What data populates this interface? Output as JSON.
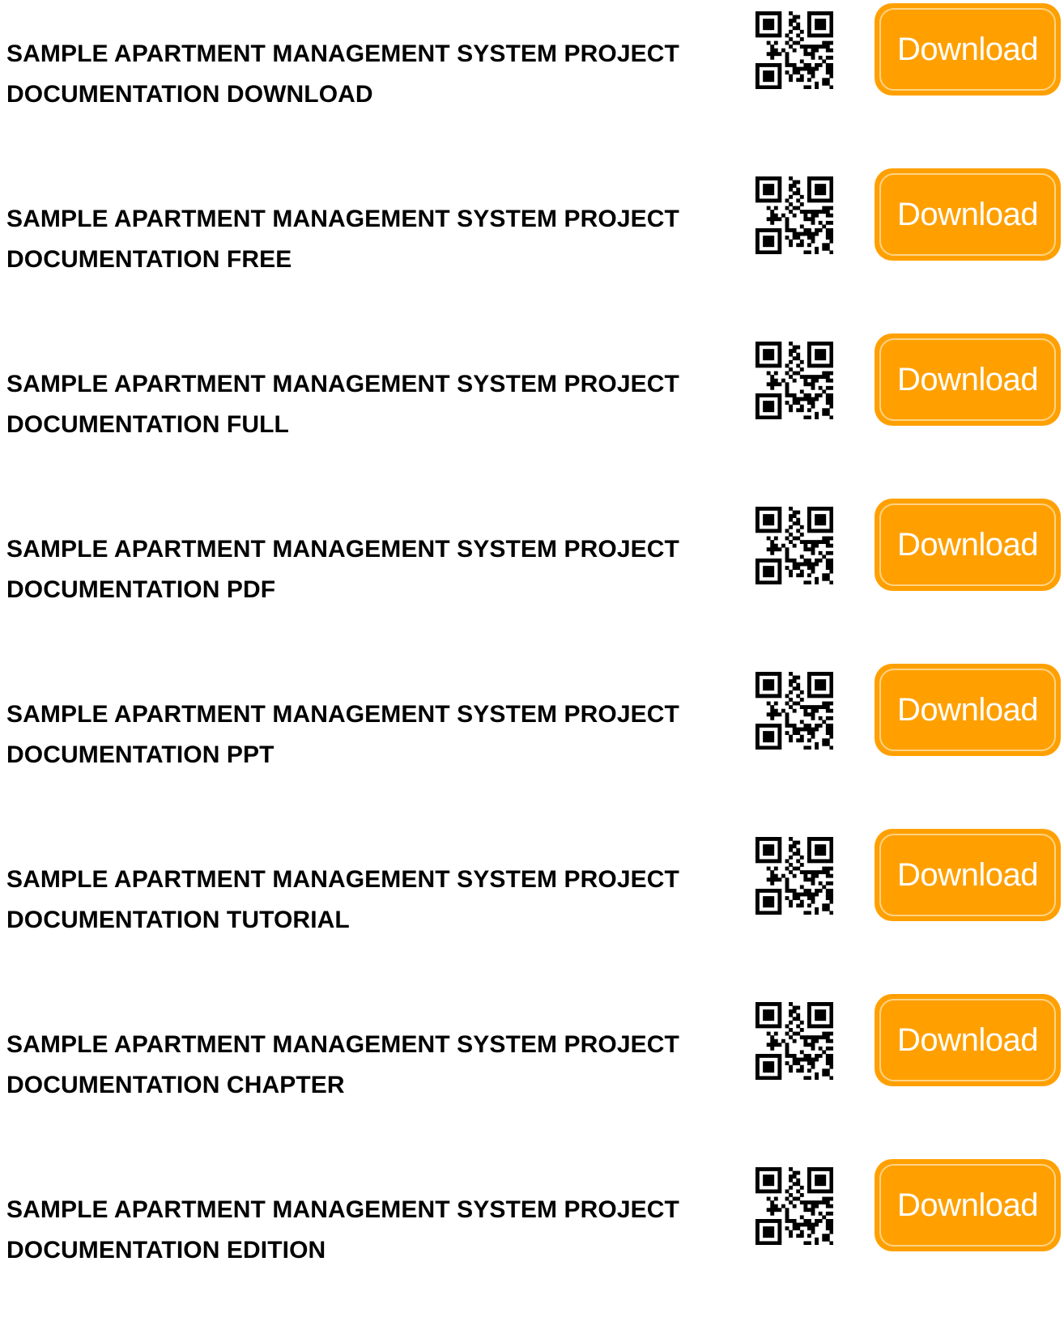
{
  "accent_color": "#ffa000",
  "rows": [
    {
      "title_line1": "SAMPLE APARTMENT MANAGEMENT SYSTEM PROJECT",
      "title_line2": "DOCUMENTATION DOWNLOAD",
      "qr_icon": "qr-code-icon",
      "button_label": "Download"
    },
    {
      "title_line1": "SAMPLE APARTMENT MANAGEMENT SYSTEM PROJECT",
      "title_line2": "DOCUMENTATION FREE",
      "qr_icon": "qr-code-icon",
      "button_label": "Download"
    },
    {
      "title_line1": "SAMPLE APARTMENT MANAGEMENT SYSTEM PROJECT",
      "title_line2": "DOCUMENTATION FULL",
      "qr_icon": "qr-code-icon",
      "button_label": "Download"
    },
    {
      "title_line1": "SAMPLE APARTMENT MANAGEMENT SYSTEM PROJECT",
      "title_line2": "DOCUMENTATION PDF",
      "qr_icon": "qr-code-icon",
      "button_label": "Download"
    },
    {
      "title_line1": "SAMPLE APARTMENT MANAGEMENT SYSTEM PROJECT",
      "title_line2": "DOCUMENTATION PPT",
      "qr_icon": "qr-code-icon",
      "button_label": "Download"
    },
    {
      "title_line1": "SAMPLE APARTMENT MANAGEMENT SYSTEM PROJECT",
      "title_line2": "DOCUMENTATION TUTORIAL",
      "qr_icon": "qr-code-icon",
      "button_label": "Download"
    },
    {
      "title_line1": "SAMPLE APARTMENT MANAGEMENT SYSTEM PROJECT",
      "title_line2": "DOCUMENTATION CHAPTER",
      "qr_icon": "qr-code-icon",
      "button_label": "Download"
    },
    {
      "title_line1": "SAMPLE APARTMENT MANAGEMENT SYSTEM PROJECT",
      "title_line2": "DOCUMENTATION EDITION",
      "qr_icon": "qr-code-icon",
      "button_label": "Download"
    }
  ]
}
